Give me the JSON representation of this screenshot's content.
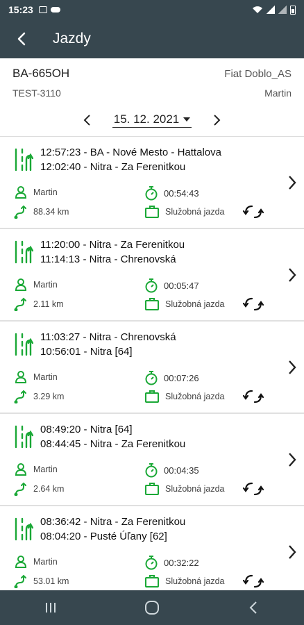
{
  "status_bar": {
    "time": "15:23"
  },
  "app_bar": {
    "title": "Jazdy"
  },
  "vehicle": {
    "plate": "BA-665OH",
    "model": "Fiat Doblo_AS",
    "code": "TEST-3110",
    "driver": "Martin"
  },
  "date_nav": {
    "date": "15. 12. 2021"
  },
  "trips": [
    {
      "end": "12:57:23 - BA - Nové Mesto - Hattalova",
      "start": "12:02:40 - Nitra - Za Ferenitkou",
      "driver": "Martin",
      "duration": "00:54:43",
      "distance": "88.34 km",
      "type": "Služobná jazda"
    },
    {
      "end": "11:20:00 - Nitra - Za Ferenitkou",
      "start": "11:14:13 - Nitra - Chrenovská",
      "driver": "Martin",
      "duration": "00:05:47",
      "distance": "2.11 km",
      "type": "Služobná jazda"
    },
    {
      "end": "11:03:27 - Nitra - Chrenovská",
      "start": "10:56:01 - Nitra [64]",
      "driver": "Martin",
      "duration": "00:07:26",
      "distance": "3.29 km",
      "type": "Služobná jazda"
    },
    {
      "end": "08:49:20 - Nitra [64]",
      "start": "08:44:45 - Nitra - Za Ferenitkou",
      "driver": "Martin",
      "duration": "00:04:35",
      "distance": "2.64 km",
      "type": "Služobná jazda"
    },
    {
      "end": "08:36:42 - Nitra - Za Ferenitkou",
      "start": "08:04:20 - Pusté Úľany [62]",
      "driver": "Martin",
      "duration": "00:32:22",
      "distance": "53.01 km",
      "type": "Služobná jazda"
    }
  ],
  "colors": {
    "accent_green": "#1aa836",
    "app_bar": "#37474f"
  }
}
